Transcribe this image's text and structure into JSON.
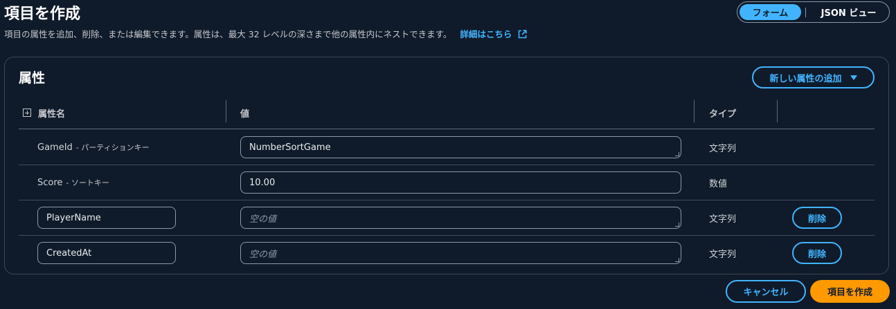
{
  "header": {
    "title": "項目を作成",
    "description": "項目の属性を追加、削除、または編集できます。属性は、最大 32 レベルの深さまで他の属性内にネストできます。",
    "learn_more": "詳細はこちら"
  },
  "view_toggle": {
    "form_label": "フォーム",
    "json_label": "JSON ビュー",
    "selected": "フォーム"
  },
  "attributes_panel": {
    "title": "属性",
    "add_button_label": "新しい属性の追加",
    "columns": {
      "name": "属性名",
      "value": "値",
      "type": "タイプ"
    },
    "rows": [
      {
        "name": "GameId",
        "key_label": "- パーティションキー",
        "value": "NumberSortGame",
        "type": "文字列"
      },
      {
        "name": "Score",
        "key_label": "- ソートキー",
        "value": "10.00",
        "type": "数値"
      },
      {
        "name": "PlayerName",
        "value_placeholder": "空の値",
        "type": "文字列",
        "delete_label": "削除"
      },
      {
        "name": "CreatedAt",
        "value_placeholder": "空の値",
        "type": "文字列",
        "delete_label": "削除"
      }
    ]
  },
  "footer": {
    "cancel_label": "キャンセル",
    "create_label": "項目を作成"
  },
  "colors": {
    "background": "#0f1b2a",
    "accent": "#42b4ff",
    "primary_button": "#ff9900"
  }
}
